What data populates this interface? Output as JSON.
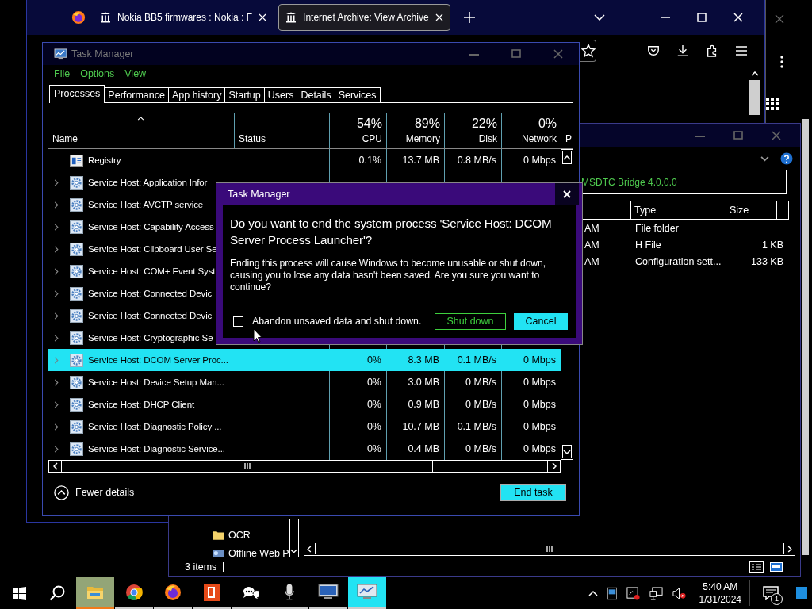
{
  "browser": {
    "tabs": [
      {
        "title": "Nokia BB5 firmwares : Nokia : F",
        "selected": false
      },
      {
        "title": "Internet Archive: View Archive",
        "selected": true
      }
    ]
  },
  "explorer": {
    "address": "MSDTC Bridge 4.0.0.0",
    "columns": [
      "Type",
      "Size"
    ],
    "rows": [
      {
        "column_1": "AM",
        "type": "File folder"
      },
      {
        "column_1": "AM",
        "type": "H File",
        "size": "1 KB"
      },
      {
        "column_1": "AM",
        "type": "Configuration sett...",
        "size": "133 KB"
      }
    ],
    "nav_items": [
      {
        "label": "OCR",
        "kind": "folder"
      },
      {
        "label": "Offline Web P",
        "kind": "web"
      }
    ],
    "status": "3 items"
  },
  "task_manager": {
    "title": "Task Manager",
    "menu": [
      "File",
      "Options",
      "View"
    ],
    "tabs": [
      {
        "label": "Processes",
        "selected": true
      },
      {
        "label": "Performance",
        "selected": false
      },
      {
        "label": "App history",
        "selected": false
      },
      {
        "label": "Startup",
        "selected": false
      },
      {
        "label": "Users",
        "selected": false
      },
      {
        "label": "Details",
        "selected": false
      },
      {
        "label": "Services",
        "selected": false
      }
    ],
    "columns": [
      {
        "label": "Name",
        "sorted": true
      },
      {
        "label": "Status",
        "sorted": false
      },
      {
        "usage": "54%",
        "label": "CPU",
        "sorted": false
      },
      {
        "usage": "89%",
        "label": "Memory",
        "sorted": false
      },
      {
        "usage": "22%",
        "label": "Disk",
        "sorted": false
      },
      {
        "usage": "0%",
        "label": "Network",
        "sorted": false
      },
      {
        "label": "P",
        "sorted": false
      }
    ],
    "rows": [
      {
        "name": "Registry",
        "kind": "registry",
        "expandable": false,
        "selected": false,
        "cpu": "0.1%",
        "memory": "13.7 MB",
        "disk": "0.8 MB/s",
        "network": "0 Mbps"
      },
      {
        "name": "Service Host: Application Infor",
        "kind": "service",
        "expandable": true,
        "selected": false
      },
      {
        "name": "Service Host: AVCTP service",
        "kind": "service",
        "expandable": true,
        "selected": false
      },
      {
        "name": "Service Host: Capability Access",
        "kind": "service",
        "expandable": true,
        "selected": false
      },
      {
        "name": "Service Host: Clipboard User Se",
        "kind": "service",
        "expandable": true,
        "selected": false
      },
      {
        "name": "Service Host: COM+ Event Syst",
        "kind": "service",
        "expandable": true,
        "selected": false
      },
      {
        "name": "Service Host: Connected Devic",
        "kind": "service",
        "expandable": true,
        "selected": false
      },
      {
        "name": "Service Host: Connected Devic",
        "kind": "service",
        "expandable": true,
        "selected": false
      },
      {
        "name": "Service Host: Cryptographic Se",
        "kind": "service",
        "expandable": true,
        "selected": false
      },
      {
        "name": "Service Host: DCOM Server Proc...",
        "kind": "service",
        "expandable": true,
        "selected": true,
        "cpu": "0%",
        "memory": "8.3 MB",
        "disk": "0.1 MB/s",
        "network": "0 Mbps"
      },
      {
        "name": "Service Host: Device Setup Man...",
        "kind": "service",
        "expandable": true,
        "selected": false,
        "cpu": "0%",
        "memory": "3.0 MB",
        "disk": "0 MB/s",
        "network": "0 Mbps"
      },
      {
        "name": "Service Host: DHCP Client",
        "kind": "service",
        "expandable": true,
        "selected": false,
        "cpu": "0%",
        "memory": "0.9 MB",
        "disk": "0 MB/s",
        "network": "0 Mbps"
      },
      {
        "name": "Service Host: Diagnostic Policy ...",
        "kind": "service",
        "expandable": true,
        "selected": false,
        "cpu": "0%",
        "memory": "10.7 MB",
        "disk": "0.1 MB/s",
        "network": "0 Mbps"
      },
      {
        "name": "Service Host: Diagnostic Service...",
        "kind": "service",
        "expandable": true,
        "selected": false,
        "cpu": "0%",
        "memory": "0.4 MB",
        "disk": "0 MB/s",
        "network": "0 Mbps"
      }
    ],
    "fewer_details": "Fewer details",
    "end_task": "End task"
  },
  "dialog": {
    "title": "Task Manager",
    "heading": "Do you want to end the system process 'Service Host: DCOM Server Process Launcher'?",
    "message": "Ending this process will cause Windows to become unusable or shut down, causing you to lose any data hasn't been saved. Are you sure you want to continue?",
    "checkbox": {
      "label": "Abandon unsaved data and shut down.",
      "checked": false
    },
    "buttons": [
      {
        "label": "Shut down",
        "kind": "secondary"
      },
      {
        "label": "Cancel",
        "kind": "primary"
      }
    ]
  },
  "taskbar": {
    "apps": [
      {
        "kind": "explorer",
        "hovered": true,
        "selected": false
      },
      {
        "kind": "chrome",
        "hovered": false,
        "selected": false
      },
      {
        "kind": "firefox",
        "hovered": false,
        "selected": false
      },
      {
        "kind": "office",
        "hovered": false,
        "selected": false
      },
      {
        "kind": "chat",
        "hovered": false,
        "selected": false
      },
      {
        "kind": "mic",
        "hovered": false,
        "selected": false
      },
      {
        "kind": "remote",
        "hovered": false,
        "selected": false
      },
      {
        "kind": "taskmgr",
        "hovered": false,
        "selected": true
      }
    ],
    "time": "5:40 AM",
    "date": "1/31/2024",
    "notifications": "1"
  }
}
